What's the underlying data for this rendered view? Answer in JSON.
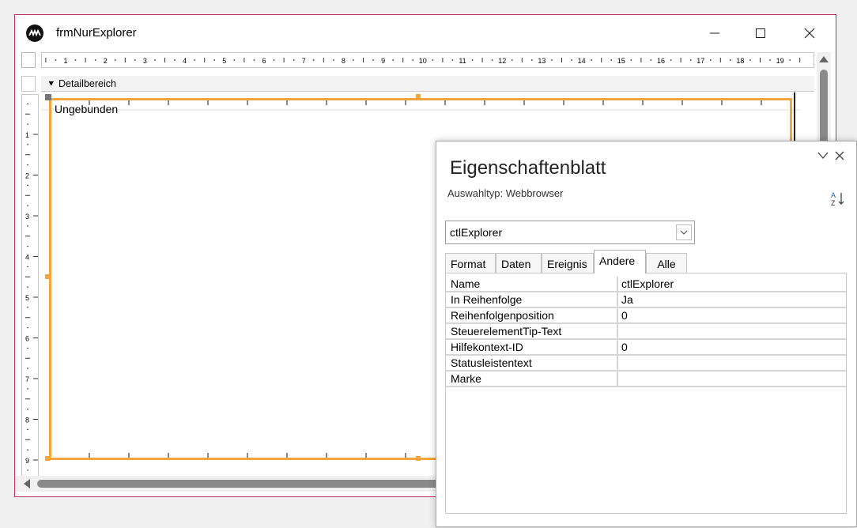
{
  "window": {
    "title": "frmNurExplorer",
    "minimize": "—",
    "maximize": "☐",
    "close": "✕"
  },
  "ruler": {
    "h_numbers": [
      "1",
      "2",
      "3",
      "4",
      "5",
      "6",
      "7",
      "8",
      "9",
      "10",
      "11",
      "12",
      "13",
      "14",
      "15",
      "16",
      "17",
      "18",
      "19"
    ],
    "v_numbers": [
      "1",
      "2",
      "3",
      "4",
      "5",
      "6",
      "7",
      "8",
      "9"
    ]
  },
  "section": {
    "label": "Detailbereich",
    "arrow": "⯆"
  },
  "control": {
    "label": "Ungebunden"
  },
  "property_sheet": {
    "title": "Eigenschaftenblatt",
    "selection_type": "Auswahltyp:  Webbrowser",
    "sort_icon": "sort-az-icon",
    "combo_value": "ctlExplorer",
    "tabs": [
      "Format",
      "Daten",
      "Ereignis",
      "Andere",
      "Alle"
    ],
    "active_tab": "Andere",
    "properties": [
      {
        "name": "Name",
        "value": "ctlExplorer"
      },
      {
        "name": "In Reihenfolge",
        "value": "Ja"
      },
      {
        "name": "Reihenfolgenposition",
        "value": "0"
      },
      {
        "name": "SteuerelementTip-Text",
        "value": ""
      },
      {
        "name": "Hilfekontext-ID",
        "value": "0"
      },
      {
        "name": "Statusleistentext",
        "value": ""
      },
      {
        "name": "Marke",
        "value": ""
      }
    ]
  }
}
